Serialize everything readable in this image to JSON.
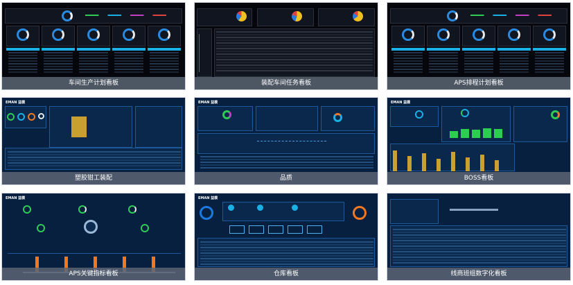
{
  "tiles": [
    {
      "caption": "车间生产计划看板"
    },
    {
      "caption": "装配车间任务看板"
    },
    {
      "caption": "APS排程计划看板"
    },
    {
      "caption": "塑胶钳工装配"
    },
    {
      "caption": "品质"
    },
    {
      "caption": "BOSS看板"
    },
    {
      "caption": "APS关键指标看板"
    },
    {
      "caption": "仓库看板"
    },
    {
      "caption": "线商班组数字化看板"
    }
  ],
  "logo_text": "EMAN 益模",
  "colors": {
    "dark_bg": "#05070d",
    "navy_bg": "#0b1a33",
    "accent_cyan": "#1ab0e6",
    "accent_orange": "#f07820",
    "accent_green": "#2ecc55",
    "accent_gold": "#c8a030"
  }
}
